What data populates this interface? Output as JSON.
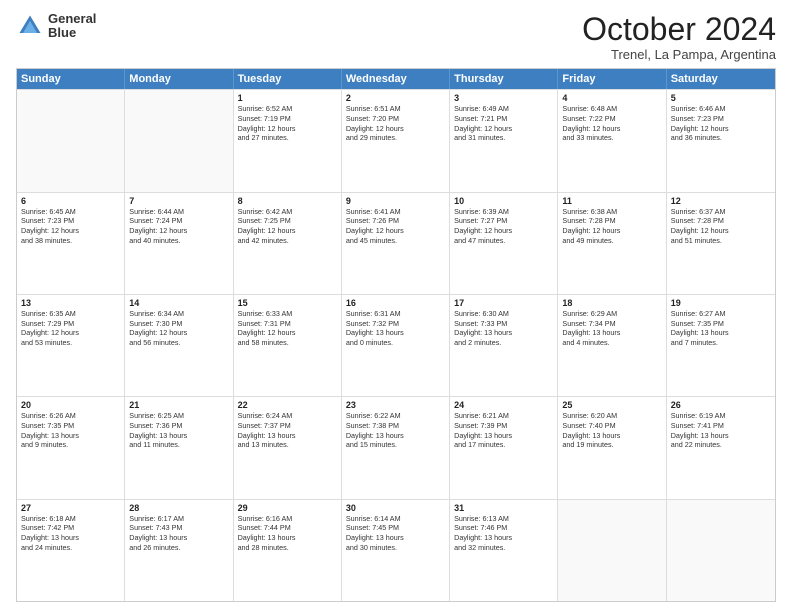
{
  "header": {
    "logo_line1": "General",
    "logo_line2": "Blue",
    "month": "October 2024",
    "location": "Trenel, La Pampa, Argentina"
  },
  "days": [
    "Sunday",
    "Monday",
    "Tuesday",
    "Wednesday",
    "Thursday",
    "Friday",
    "Saturday"
  ],
  "rows": [
    [
      {
        "day": "",
        "text": ""
      },
      {
        "day": "",
        "text": ""
      },
      {
        "day": "1",
        "text": "Sunrise: 6:52 AM\nSunset: 7:19 PM\nDaylight: 12 hours\nand 27 minutes."
      },
      {
        "day": "2",
        "text": "Sunrise: 6:51 AM\nSunset: 7:20 PM\nDaylight: 12 hours\nand 29 minutes."
      },
      {
        "day": "3",
        "text": "Sunrise: 6:49 AM\nSunset: 7:21 PM\nDaylight: 12 hours\nand 31 minutes."
      },
      {
        "day": "4",
        "text": "Sunrise: 6:48 AM\nSunset: 7:22 PM\nDaylight: 12 hours\nand 33 minutes."
      },
      {
        "day": "5",
        "text": "Sunrise: 6:46 AM\nSunset: 7:23 PM\nDaylight: 12 hours\nand 36 minutes."
      }
    ],
    [
      {
        "day": "6",
        "text": "Sunrise: 6:45 AM\nSunset: 7:23 PM\nDaylight: 12 hours\nand 38 minutes."
      },
      {
        "day": "7",
        "text": "Sunrise: 6:44 AM\nSunset: 7:24 PM\nDaylight: 12 hours\nand 40 minutes."
      },
      {
        "day": "8",
        "text": "Sunrise: 6:42 AM\nSunset: 7:25 PM\nDaylight: 12 hours\nand 42 minutes."
      },
      {
        "day": "9",
        "text": "Sunrise: 6:41 AM\nSunset: 7:26 PM\nDaylight: 12 hours\nand 45 minutes."
      },
      {
        "day": "10",
        "text": "Sunrise: 6:39 AM\nSunset: 7:27 PM\nDaylight: 12 hours\nand 47 minutes."
      },
      {
        "day": "11",
        "text": "Sunrise: 6:38 AM\nSunset: 7:28 PM\nDaylight: 12 hours\nand 49 minutes."
      },
      {
        "day": "12",
        "text": "Sunrise: 6:37 AM\nSunset: 7:28 PM\nDaylight: 12 hours\nand 51 minutes."
      }
    ],
    [
      {
        "day": "13",
        "text": "Sunrise: 6:35 AM\nSunset: 7:29 PM\nDaylight: 12 hours\nand 53 minutes."
      },
      {
        "day": "14",
        "text": "Sunrise: 6:34 AM\nSunset: 7:30 PM\nDaylight: 12 hours\nand 56 minutes."
      },
      {
        "day": "15",
        "text": "Sunrise: 6:33 AM\nSunset: 7:31 PM\nDaylight: 12 hours\nand 58 minutes."
      },
      {
        "day": "16",
        "text": "Sunrise: 6:31 AM\nSunset: 7:32 PM\nDaylight: 13 hours\nand 0 minutes."
      },
      {
        "day": "17",
        "text": "Sunrise: 6:30 AM\nSunset: 7:33 PM\nDaylight: 13 hours\nand 2 minutes."
      },
      {
        "day": "18",
        "text": "Sunrise: 6:29 AM\nSunset: 7:34 PM\nDaylight: 13 hours\nand 4 minutes."
      },
      {
        "day": "19",
        "text": "Sunrise: 6:27 AM\nSunset: 7:35 PM\nDaylight: 13 hours\nand 7 minutes."
      }
    ],
    [
      {
        "day": "20",
        "text": "Sunrise: 6:26 AM\nSunset: 7:35 PM\nDaylight: 13 hours\nand 9 minutes."
      },
      {
        "day": "21",
        "text": "Sunrise: 6:25 AM\nSunset: 7:36 PM\nDaylight: 13 hours\nand 11 minutes."
      },
      {
        "day": "22",
        "text": "Sunrise: 6:24 AM\nSunset: 7:37 PM\nDaylight: 13 hours\nand 13 minutes."
      },
      {
        "day": "23",
        "text": "Sunrise: 6:22 AM\nSunset: 7:38 PM\nDaylight: 13 hours\nand 15 minutes."
      },
      {
        "day": "24",
        "text": "Sunrise: 6:21 AM\nSunset: 7:39 PM\nDaylight: 13 hours\nand 17 minutes."
      },
      {
        "day": "25",
        "text": "Sunrise: 6:20 AM\nSunset: 7:40 PM\nDaylight: 13 hours\nand 19 minutes."
      },
      {
        "day": "26",
        "text": "Sunrise: 6:19 AM\nSunset: 7:41 PM\nDaylight: 13 hours\nand 22 minutes."
      }
    ],
    [
      {
        "day": "27",
        "text": "Sunrise: 6:18 AM\nSunset: 7:42 PM\nDaylight: 13 hours\nand 24 minutes."
      },
      {
        "day": "28",
        "text": "Sunrise: 6:17 AM\nSunset: 7:43 PM\nDaylight: 13 hours\nand 26 minutes."
      },
      {
        "day": "29",
        "text": "Sunrise: 6:16 AM\nSunset: 7:44 PM\nDaylight: 13 hours\nand 28 minutes."
      },
      {
        "day": "30",
        "text": "Sunrise: 6:14 AM\nSunset: 7:45 PM\nDaylight: 13 hours\nand 30 minutes."
      },
      {
        "day": "31",
        "text": "Sunrise: 6:13 AM\nSunset: 7:46 PM\nDaylight: 13 hours\nand 32 minutes."
      },
      {
        "day": "",
        "text": ""
      },
      {
        "day": "",
        "text": ""
      }
    ]
  ]
}
